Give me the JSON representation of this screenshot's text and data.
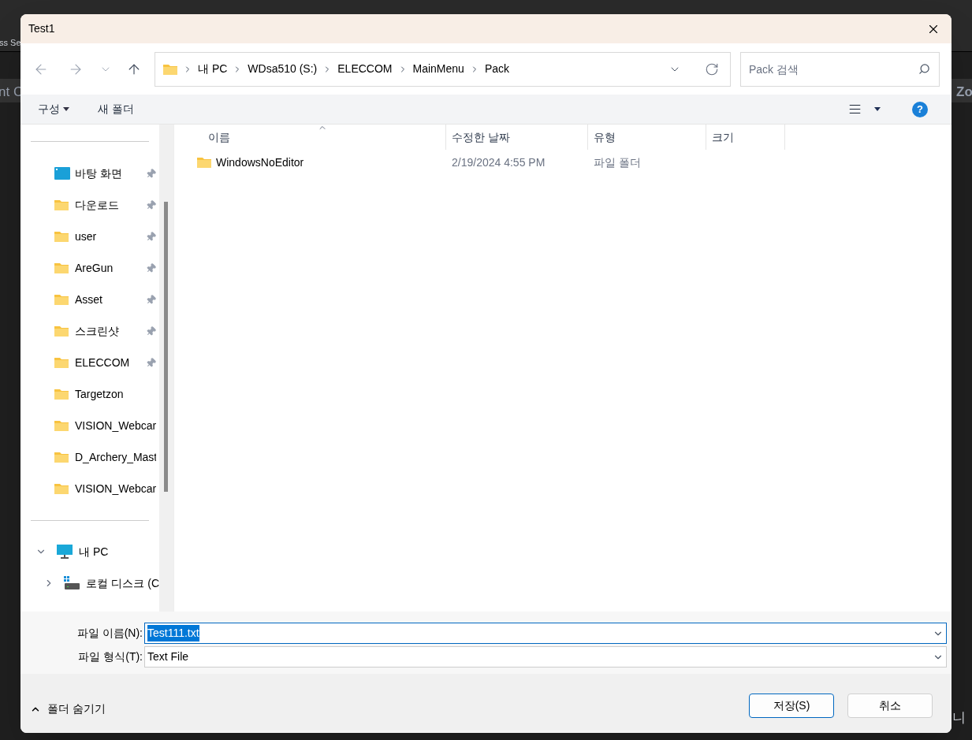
{
  "background": {
    "toolbar_label": "ss Se",
    "panel_label": "nt C",
    "right_label": "Zo",
    "bottom_label": "니"
  },
  "help": "?",
  "window": {
    "title": "Test1"
  },
  "address": {
    "path": [
      "내 PC",
      "WDsa510 (S:)",
      "ELECCOM",
      "MainMenu",
      "Pack"
    ]
  },
  "search": {
    "placeholder": "Pack 검색"
  },
  "toolbar": {
    "organize": "구성",
    "new_folder": "새 폴더"
  },
  "sidebar": {
    "quick_access": [
      {
        "label": "바탕 화면",
        "kind": "desktop",
        "pinned": true
      },
      {
        "label": "다운로드",
        "kind": "folder",
        "pinned": true
      },
      {
        "label": "user",
        "kind": "folder",
        "pinned": true
      },
      {
        "label": "AreGun",
        "kind": "folder",
        "pinned": true
      },
      {
        "label": "Asset",
        "kind": "folder",
        "pinned": true
      },
      {
        "label": "스크린샷",
        "kind": "folder",
        "pinned": true
      },
      {
        "label": "ELECCOM",
        "kind": "folder",
        "pinned": true
      },
      {
        "label": "Targetzon",
        "kind": "folder",
        "pinned": false
      },
      {
        "label": "VISION_Webcar",
        "kind": "folder",
        "pinned": false
      },
      {
        "label": "D_Archery_Mast",
        "kind": "folder",
        "pinned": false
      },
      {
        "label": "VISION_Webcar",
        "kind": "folder",
        "pinned": false
      }
    ],
    "tree": [
      {
        "label": "내 PC",
        "kind": "pc",
        "expanded": true,
        "children": [
          {
            "label": "로컬 디스크 (C",
            "kind": "drive",
            "expanded": false
          }
        ]
      }
    ]
  },
  "table": {
    "columns": [
      "이름",
      "수정한 날짜",
      "유형",
      "크기"
    ],
    "rows": [
      {
        "name": "WindowsNoEditor",
        "modified": "2/19/2024 4:55 PM",
        "type": "파일 폴더",
        "selected": false
      }
    ]
  },
  "file_name": {
    "label": "파일 이름(N):",
    "value": "Test111.txt"
  },
  "file_type": {
    "label": "파일 형식(T):",
    "value": "Text File"
  },
  "hide_folders": "폴더 숨기기",
  "buttons": [
    {
      "label": "저장(S)",
      "kind": "primary"
    },
    {
      "label": "취소",
      "kind": "secondary"
    }
  ]
}
